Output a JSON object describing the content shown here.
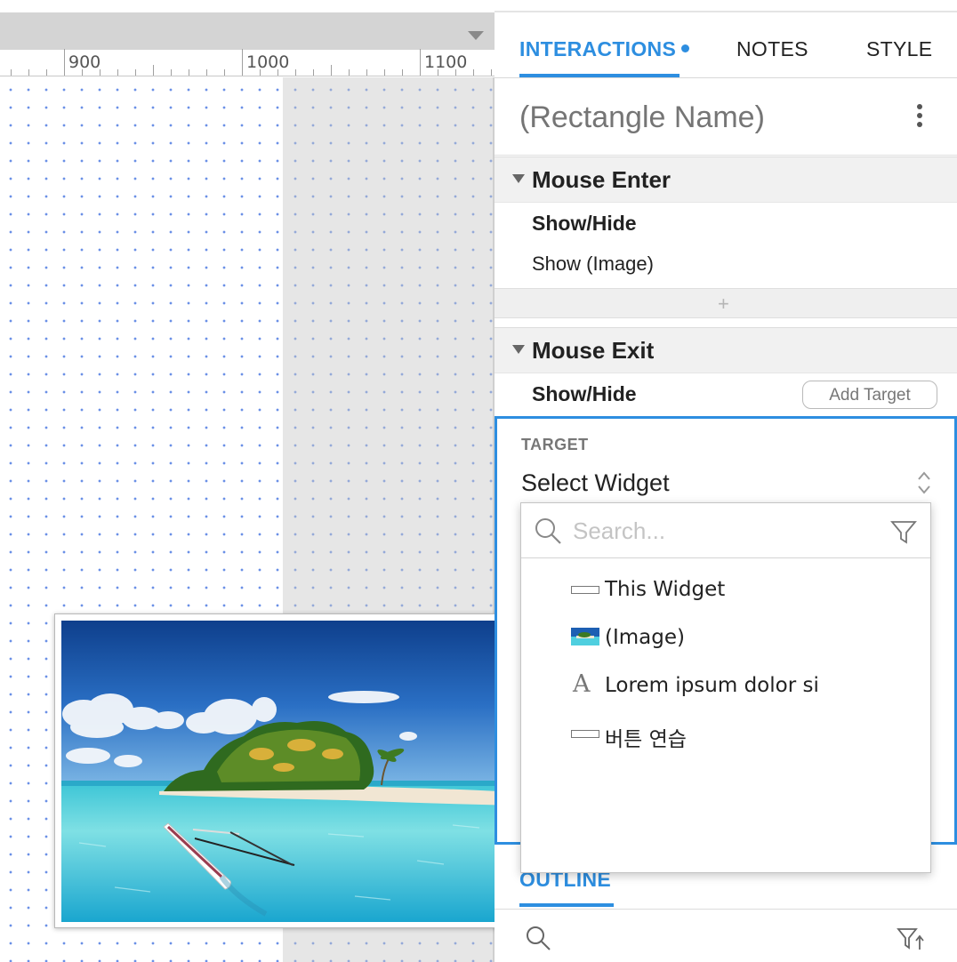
{
  "ruler": {
    "labels": [
      "900",
      "1000",
      "1100"
    ]
  },
  "tabs": [
    {
      "label": "INTERACTIONS",
      "active": true,
      "has_dot": true
    },
    {
      "label": "NOTES",
      "active": false
    },
    {
      "label": "STYLE",
      "active": false
    }
  ],
  "widget_name": {
    "placeholder": "(Rectangle Name)"
  },
  "events": [
    {
      "name": "Mouse Enter",
      "action": "Show/Hide",
      "detail": "Show (Image)"
    },
    {
      "name": "Mouse Exit",
      "action": "Show/Hide",
      "add_target_label": "Add Target"
    }
  ],
  "add_action_symbol": "+",
  "target": {
    "label": "TARGET",
    "selected": "Select Widget"
  },
  "picker": {
    "search_placeholder": "Search...",
    "items": [
      {
        "label": "This Widget",
        "icon": "rectangle-widget-icon"
      },
      {
        "label": "(Image)",
        "icon": "image-thumbnail-icon"
      },
      {
        "label": "Lorem ipsum dolor si",
        "icon": "text-widget-icon",
        "icon_glyph": "A"
      },
      {
        "label": "버튼 연습",
        "icon": "rectangle-widget-icon"
      }
    ]
  },
  "outline": {
    "tab_label": "OUTLINE"
  },
  "colors": {
    "accent": "#2d8ee0",
    "grid_dot": "#6a90e6",
    "section_bg": "#f1f1f1",
    "placeholder": "#c8c8c8"
  }
}
